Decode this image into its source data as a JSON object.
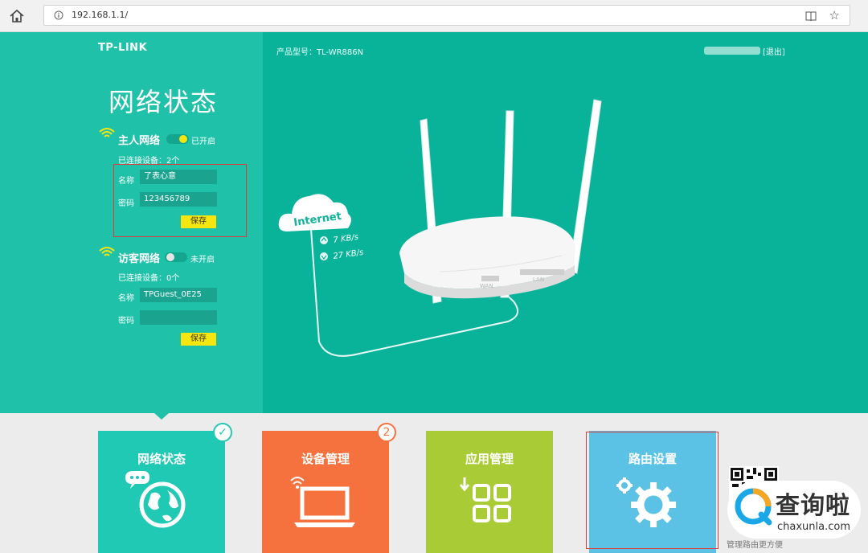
{
  "browser": {
    "url": "192.168.1.1/"
  },
  "header": {
    "logo": "TP-LINK",
    "model": "产品型号：TL-WR886N",
    "logout": "[退出]"
  },
  "sidebar": {
    "title": "网络状态",
    "main_network": {
      "title": "主人网络",
      "toggle_state": "已开启",
      "connected": "已连接设备：2个",
      "name_label": "名称",
      "name_value": "了表心意",
      "password_label": "密码",
      "password_value": "123456789",
      "save_label": "保存"
    },
    "guest_network": {
      "title": "访客网络",
      "toggle_state": "未开启",
      "connected": "已连接设备：0个",
      "name_label": "名称",
      "name_value": "TPGuest_0E25",
      "password_label": "密码",
      "password_value": "",
      "save_label": "保存"
    }
  },
  "illustration": {
    "cloud_label": "Internet",
    "upload_speed": "7 KB/s",
    "download_speed": "27 KB/s",
    "wan_label": "WAN",
    "lan_label": "LAN"
  },
  "tiles": [
    {
      "label": "网络状态",
      "color": "#20c9b3"
    },
    {
      "label": "设备管理",
      "color": "#f5713d",
      "badge": "2"
    },
    {
      "label": "应用管理",
      "color": "#a9cb35"
    },
    {
      "label": "路由设置",
      "color": "#5bc2e6"
    }
  ],
  "qr_caption": "管理路由更方便",
  "watermark": {
    "text": "查询啦",
    "sub": "chaxunla.com"
  },
  "colors": {
    "page_bg": "#09b39a",
    "sidebar_bg": "#20c1a9",
    "save_button": "#f6e60f",
    "highlight": "#e23a3a"
  }
}
